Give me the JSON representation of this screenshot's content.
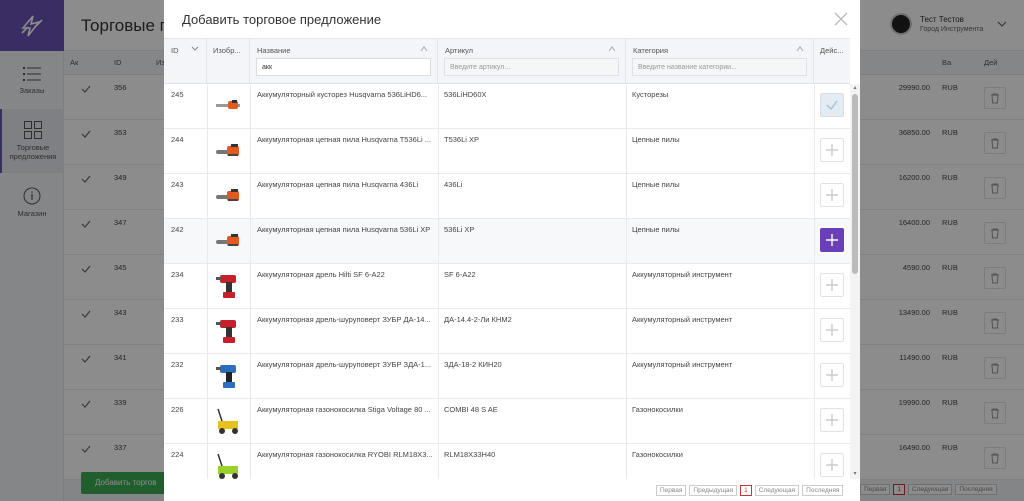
{
  "sidebar": {
    "items": [
      {
        "label": "Заказы",
        "icon": "list-icon"
      },
      {
        "label": "Торговые предложения",
        "icon": "grid-icon"
      },
      {
        "label": "Магазин",
        "icon": "info-icon"
      }
    ]
  },
  "page": {
    "title": "Торговые п",
    "add_button": "Добавить торгов",
    "columns": [
      "Ак",
      "ID",
      "Из",
      "Ва",
      "Дей"
    ]
  },
  "user": {
    "name": "Тест Тестов",
    "company": "Город Инструмента"
  },
  "bg_rows": [
    {
      "id": "356",
      "price": "29990.00",
      "currency": "RUB"
    },
    {
      "id": "353",
      "price": "36850.00",
      "currency": "RUB"
    },
    {
      "id": "349",
      "price": "16200.00",
      "currency": "RUB"
    },
    {
      "id": "347",
      "price": "16400.00",
      "currency": "RUB"
    },
    {
      "id": "345",
      "price": "4590.00",
      "currency": "RUB"
    },
    {
      "id": "343",
      "price": "13490.00",
      "currency": "RUB"
    },
    {
      "id": "341",
      "price": "11490.00",
      "currency": "RUB"
    },
    {
      "id": "339",
      "price": "19990.00",
      "currency": "RUB"
    },
    {
      "id": "337",
      "price": "16490.00",
      "currency": "RUB"
    }
  ],
  "modal": {
    "title": "Добавить торговое предложение",
    "columns": {
      "id": "ID",
      "image": "Изобр...",
      "name": "Название",
      "sku": "Артикул",
      "category": "Категория",
      "actions": "Дейс..."
    },
    "filters": {
      "name_value": "акк",
      "sku_placeholder": "Введите артикул...",
      "category_placeholder": "Введите название категории..."
    },
    "rows": [
      {
        "id": "245",
        "name": "Аккумуляторный кусторез Husqvarna 536LiHD6...",
        "sku": "536LiHD60X",
        "category": "Кусторезы",
        "state": "added",
        "pic": "hedge-trimmer"
      },
      {
        "id": "244",
        "name": "Аккумуляторная цепная пила Husqvarna T536Li ...",
        "sku": "T536Li XP",
        "category": "Цепные пилы",
        "state": "add",
        "pic": "chainsaw"
      },
      {
        "id": "243",
        "name": "Аккумуляторная цепная пила Husqvarna 436Li",
        "sku": "436Li",
        "category": "Цепные пилы",
        "state": "add",
        "pic": "chainsaw"
      },
      {
        "id": "242",
        "name": "Аккумуляторная цепная пила Husqvarna 536Li XP",
        "sku": "536Li XP",
        "category": "Цепные пилы",
        "state": "hover",
        "pic": "chainsaw"
      },
      {
        "id": "234",
        "name": "Аккумуляторная дрель Hilti SF 6-A22",
        "sku": "SF 6-A22",
        "category": "Аккумуляторный инструмент",
        "state": "add",
        "pic": "drill-red"
      },
      {
        "id": "233",
        "name": "Аккумуляторная дрель-шуруповерт ЗУБР ДА-14...",
        "sku": "ДА-14.4-2-Ли КНМ2",
        "category": "Аккумуляторный инструмент",
        "state": "add",
        "pic": "drill-red"
      },
      {
        "id": "232",
        "name": "Аккумуляторная дрель-шуруповерт ЗУБР ЗДА-1...",
        "sku": "ЗДА-18-2 КИН20",
        "category": "Аккумуляторный инструмент",
        "state": "add",
        "pic": "drill-blue"
      },
      {
        "id": "226",
        "name": "Аккумуляторная газонокосилка Stiga Voltage 80 ...",
        "sku": "COMBI 48 S AE",
        "category": "Газонокосилки",
        "state": "add",
        "pic": "mower-yellow"
      },
      {
        "id": "224",
        "name": "Аккумуляторная газонокосилка RYOBI RLM18X3...",
        "sku": "RLM18X33H40",
        "category": "Газонокосилки",
        "state": "add",
        "pic": "mower-green"
      }
    ]
  },
  "pagination": {
    "first": "Первая",
    "prev": "Предыдущая",
    "page": "1",
    "next": "Следующая",
    "last": "Последняя"
  },
  "colors": {
    "brand": "#6a53b7",
    "accent_button": "#6a3fb8",
    "green": "#3cab55"
  }
}
